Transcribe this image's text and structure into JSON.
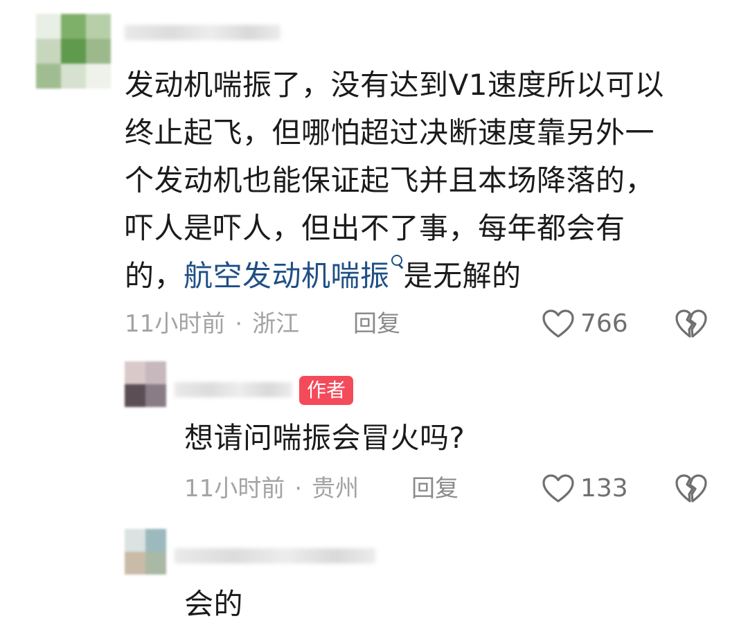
{
  "comments": [
    {
      "text_lines": [
        "发动机喘振了，没有达到V1速度所以可以",
        "终止起飞，但哪怕超过决断速度靠另外一",
        "个发动机也能保证起飞并且本场降落的，",
        "吓人是吓人，但出不了事，每年都会有"
      ],
      "last_line_prefix": "的，",
      "link_text": "航空发动机喘振",
      "last_line_suffix": "是无解的",
      "time": "11小时前",
      "location": "浙江",
      "reply_label": "回复",
      "like_count": "766"
    },
    {
      "author_badge": "作者",
      "text": "想请问喘振会冒火吗?",
      "time": "11小时前",
      "location": "贵州",
      "reply_label": "回复",
      "like_count": "133"
    },
    {
      "text": "会的"
    }
  ],
  "meta_separator": "·",
  "icons": {
    "like": "heart-outline-icon",
    "dislike": "broken-heart-icon",
    "link_search": "search-icon"
  },
  "colors": {
    "link": "#1f4f86",
    "badge": "#f44a5a",
    "meta": "#a3a3a3"
  }
}
